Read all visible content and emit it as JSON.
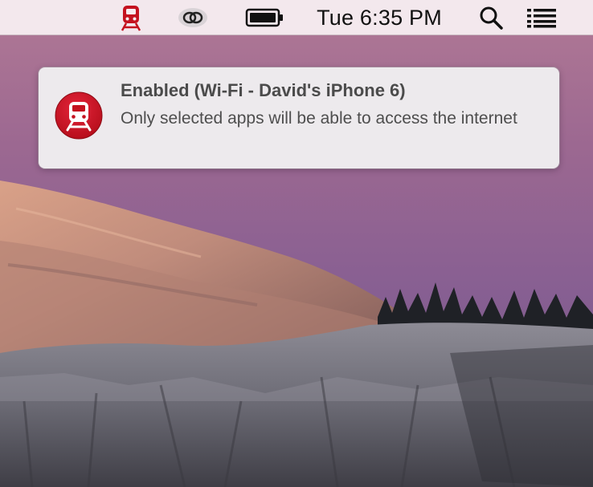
{
  "menubar": {
    "clock": "Tue 6:35 PM",
    "icons": [
      "train-icon",
      "link-rings-icon",
      "battery-icon",
      "spotlight-search-icon",
      "notification-center-icon"
    ]
  },
  "notification": {
    "title": "Enabled (Wi-Fi - David's iPhone 6)",
    "body": "Only selected apps will be able to access the internet",
    "icon": "train-icon"
  },
  "colors": {
    "app_red": "#c4121f",
    "menubar_bg": "#f6ecf0"
  }
}
